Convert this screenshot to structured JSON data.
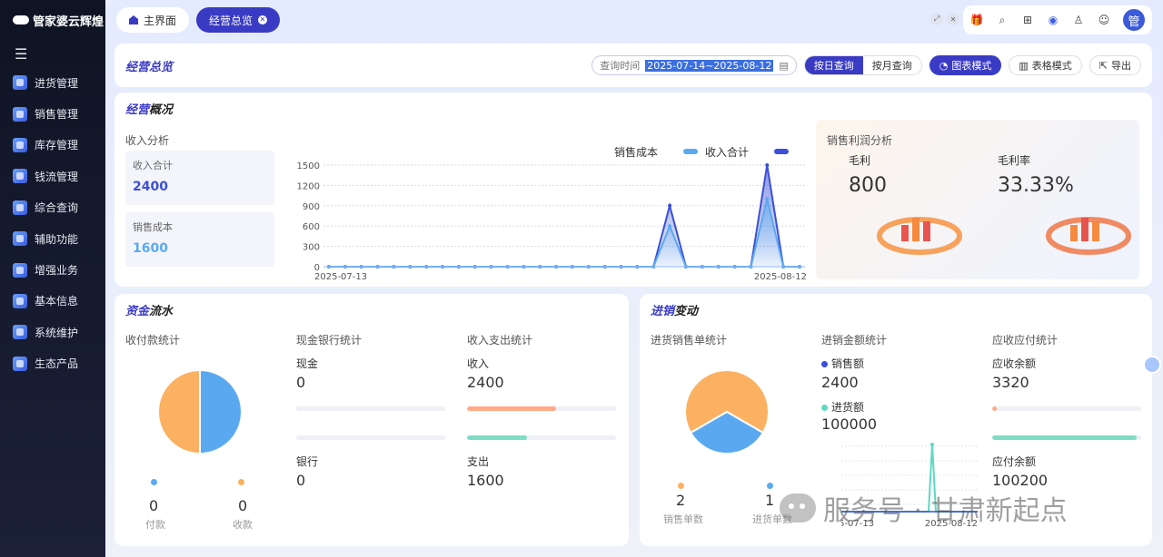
{
  "app": {
    "logo_text": "管家婆云辉煌"
  },
  "sidebar": {
    "items": [
      {
        "label": "进货管理"
      },
      {
        "label": "销售管理"
      },
      {
        "label": "库存管理"
      },
      {
        "label": "钱流管理"
      },
      {
        "label": "综合查询"
      },
      {
        "label": "辅助功能"
      },
      {
        "label": "增强业务"
      },
      {
        "label": "基本信息"
      },
      {
        "label": "系统维护"
      },
      {
        "label": "生态产品"
      }
    ]
  },
  "tabs": [
    {
      "label": "主界面"
    },
    {
      "label": "经营总览"
    }
  ],
  "toolbar": {
    "avatar": "管",
    "icons": [
      "gift-icon",
      "search-icon",
      "apps-icon",
      "eye-icon",
      "user-icon",
      "chat-icon"
    ]
  },
  "header": {
    "title_prefix": "经营",
    "title_suffix": "总览",
    "date_label": "查询时间",
    "date_value": "2025-07-14~2025-08-12",
    "by_day": "按日查询",
    "by_month": "按月查询",
    "chart_mode": "图表模式",
    "table_mode": "表格模式",
    "export": "导出"
  },
  "overview": {
    "title_prefix": "经营",
    "title_suffix": "概况",
    "income_title": "收入分析",
    "income_total_label": "收入合计",
    "income_total_value": "2400",
    "cost_label": "销售成本",
    "cost_value": "1600",
    "profit_title": "销售利润分析",
    "gross_profit_label": "毛利",
    "gross_profit_value": "800",
    "gross_margin_label": "毛利率",
    "gross_margin_value": "33.33%"
  },
  "chart_data": {
    "type": "area",
    "series": [
      {
        "name": "销售成本",
        "color": "#5aa9f0",
        "values": [
          0,
          0,
          0,
          0,
          0,
          0,
          0,
          0,
          0,
          0,
          0,
          0,
          0,
          0,
          0,
          0,
          0,
          0,
          0,
          0,
          0,
          600,
          0,
          0,
          0,
          0,
          0,
          1000,
          0,
          0
        ]
      },
      {
        "name": "收入合计",
        "color": "#3b4fd8",
        "values": [
          0,
          0,
          0,
          0,
          0,
          0,
          0,
          0,
          0,
          0,
          0,
          0,
          0,
          0,
          0,
          0,
          0,
          0,
          0,
          0,
          0,
          900,
          0,
          0,
          0,
          0,
          0,
          1500,
          0,
          0
        ]
      }
    ],
    "x_start_label": "2025-07-13",
    "x_end_label": "2025-08-12",
    "y_ticks": [
      "1500",
      "1200",
      "900",
      "600",
      "300",
      "0"
    ],
    "ylim": [
      0,
      1500
    ],
    "grid": true,
    "legend_position": "top-right"
  },
  "funds": {
    "title_prefix": "资金",
    "title_suffix": "流水",
    "receipts_title": "收付款统计",
    "pay_value": "0",
    "pay_label": "付款",
    "receive_value": "0",
    "receive_label": "收款",
    "pie_colors": [
      "#5aa9f0",
      "#fbb161"
    ],
    "pie_values": [
      50,
      50
    ],
    "cash_bank_title": "现金银行统计",
    "cash_label": "现金",
    "cash_value": "0",
    "bank_label": "银行",
    "bank_value": "0",
    "income_expense_title": "收入支出统计",
    "income_label": "收入",
    "income_value": "2400",
    "income_bar_fraction": 0.6,
    "income_bar_color": "#ffab8a",
    "expense_label": "支出",
    "expense_value": "1600",
    "expense_bar_fraction": 0.4,
    "expense_bar_color": "#7fdcc6"
  },
  "inventory": {
    "title_prefix": "进销",
    "title_suffix": "变动",
    "orders_title": "进货销售单统计",
    "sales_count": "2",
    "sales_count_label": "销售单数",
    "purchase_count": "1",
    "purchase_count_label": "进货单数",
    "pie_values": [
      2,
      1
    ],
    "pie_colors": [
      "#fbb161",
      "#5aa9f0"
    ],
    "amount_title": "进销金额统计",
    "sales_amount_label": "销售额",
    "sales_amount_value": "2400",
    "purchase_amount_label": "进货额",
    "purchase_amount_value": "100000",
    "mini_x_start": "2025-07-13",
    "mini_x_end": "2025-08-12",
    "ar_ap_title": "应收应付统计",
    "receivable_label": "应收余额",
    "receivable_value": "3320",
    "receivable_fraction": 0.03,
    "payable_label": "应付余额",
    "payable_value": "100200",
    "payable_fraction": 0.97
  },
  "watermark": "服务号 · 甘肃新起点"
}
